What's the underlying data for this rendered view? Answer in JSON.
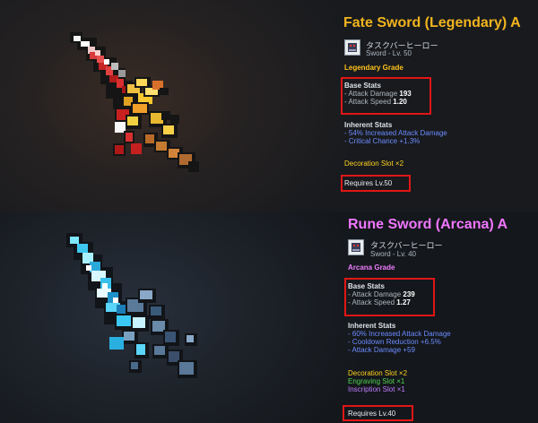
{
  "items": [
    {
      "title": "Fate Sword (Legendary) A",
      "title_color": "#f2b41e",
      "icon": "hero-avatar-icon",
      "owner": "タスクバーヒーロー",
      "type_level": "Sword - Lv. 50",
      "grade": "Legendary Grade",
      "grade_color": "#ffc21a",
      "base_stats": {
        "heading": "Base Stats",
        "attack_damage_label": "- Attack Damage",
        "attack_damage_value": "193",
        "attack_speed_label": "- Attack Speed",
        "attack_speed_value": "1.20"
      },
      "inherent": {
        "heading": "Inherent Stats",
        "lines": [
          "- 54% Increased Attack Damage",
          "- Critical Chance +1.3%"
        ]
      },
      "slots": [
        "Decoration Slot ×2"
      ],
      "requires": "Requires Lv.50"
    },
    {
      "title": "Rune Sword (Arcana) A",
      "title_color": "#f176ff",
      "icon": "hero-avatar-icon",
      "owner": "タスクバーヒーロー",
      "type_level": "Sword - Lv. 40",
      "grade": "Arcana Grade",
      "grade_color": "#ee7cff",
      "base_stats": {
        "heading": "Base Stats",
        "attack_damage_label": "- Attack Damage",
        "attack_damage_value": "239",
        "attack_speed_label": "- Attack Speed",
        "attack_speed_value": "1.27"
      },
      "inherent": {
        "heading": "Inherent Stats",
        "lines": [
          "- 60% Increased Attack Damage",
          "- Cooldown Reduction +6.5%",
          "- Attack Damage +59"
        ]
      },
      "slots": [
        "Decoration Slot ×2",
        "Engraving Slot ×1",
        "Inscription Slot ×1"
      ],
      "requires": "Requires Lv.40"
    }
  ]
}
